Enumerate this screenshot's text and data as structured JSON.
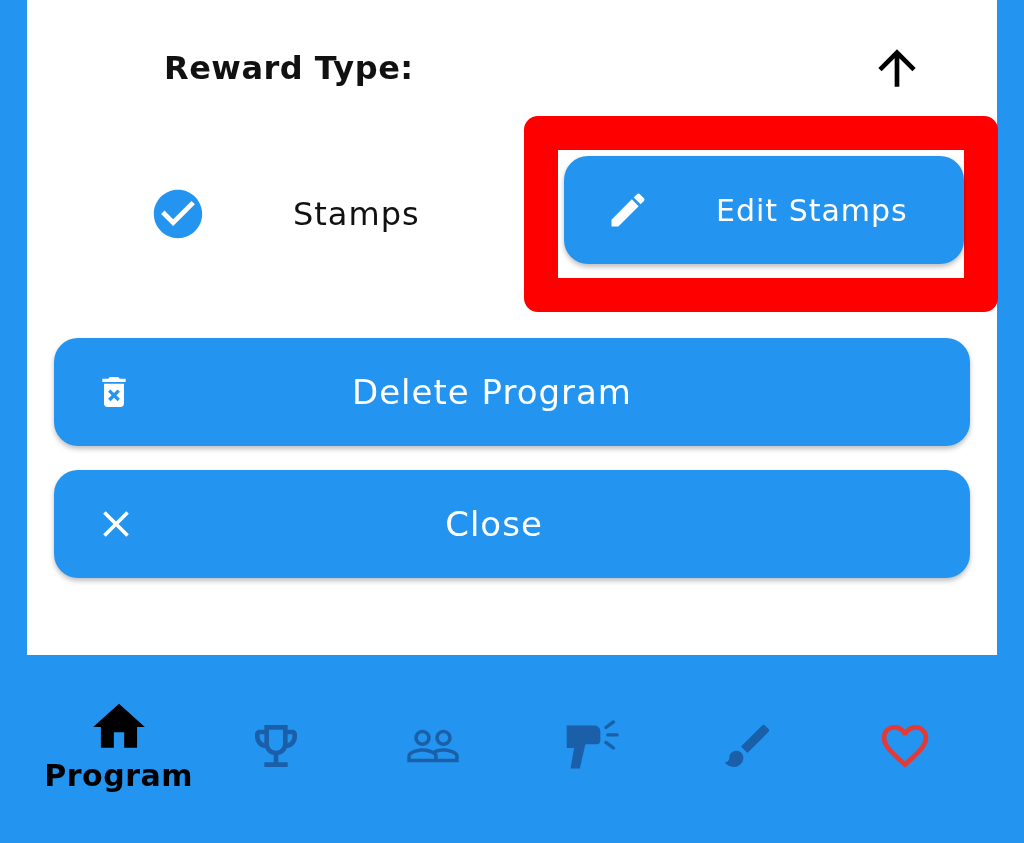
{
  "reward_type": {
    "label": "Reward Type:",
    "option": {
      "label": "Stamps",
      "checked": true
    },
    "edit_button": {
      "label": "Edit Stamps",
      "highlighted": true
    }
  },
  "buttons": [
    {
      "kind": "delete",
      "label": "Delete Program"
    },
    {
      "kind": "close",
      "label": "Close"
    }
  ],
  "nav": [
    {
      "kind": "home",
      "label": "Program",
      "selected": true,
      "color": "#000000"
    },
    {
      "kind": "trophy",
      "selected": false,
      "color": "#1a5fa8"
    },
    {
      "kind": "people",
      "selected": false,
      "color": "#1a5fa8"
    },
    {
      "kind": "scanner",
      "selected": false,
      "color": "#1a5fa8"
    },
    {
      "kind": "brush",
      "selected": false,
      "color": "#1a5fa8"
    },
    {
      "kind": "heart",
      "selected": false,
      "color": "#e53935"
    }
  ]
}
